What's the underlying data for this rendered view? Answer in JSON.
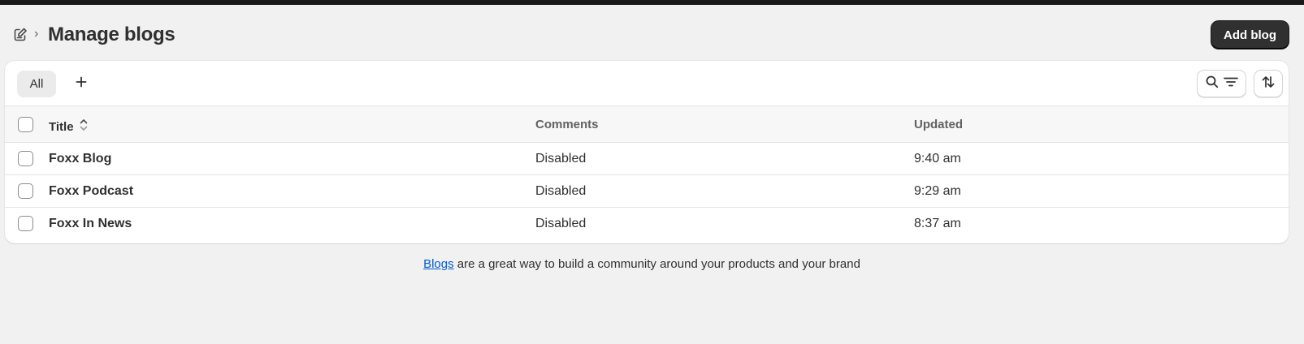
{
  "header": {
    "breadcrumb_icon": "edit-document-icon",
    "breadcrumb_separator": "›",
    "title": "Manage blogs",
    "add_button_label": "Add blog"
  },
  "tabs": [
    {
      "label": "All",
      "selected": true
    }
  ],
  "toolbar": {
    "add_view_icon": "plus-icon",
    "search_icon": "search-icon",
    "filter_icon": "filter-lines-icon",
    "sort_icon": "sort-arrows-icon"
  },
  "table": {
    "columns": [
      "Title",
      "Comments",
      "Updated"
    ],
    "title_sort_icon": "sort-chevrons-icon",
    "rows": [
      {
        "title": "Foxx Blog",
        "comments": "Disabled",
        "updated": "9:40 am"
      },
      {
        "title": "Foxx Podcast",
        "comments": "Disabled",
        "updated": "9:29 am"
      },
      {
        "title": "Foxx In News",
        "comments": "Disabled",
        "updated": "8:37 am"
      }
    ]
  },
  "footer": {
    "link_text": "Blogs",
    "text": " are a great way to build a community around your products and your brand"
  },
  "colors": {
    "primary_button": "#303030",
    "link": "#005bd3",
    "page_background": "#f1f1f1"
  }
}
